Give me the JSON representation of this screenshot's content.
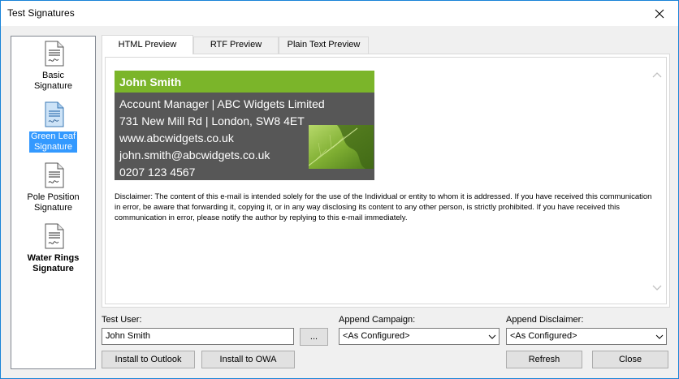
{
  "window": {
    "title": "Test Signatures"
  },
  "signatures": [
    {
      "label_line1": "Basic",
      "label_line2": "Signature",
      "selected": false,
      "bold": false
    },
    {
      "label_line1": "Green Leaf",
      "label_line2": "Signature",
      "selected": true,
      "bold": false
    },
    {
      "label_line1": "Pole Position",
      "label_line2": "Signature",
      "selected": false,
      "bold": false
    },
    {
      "label_line1": "Water Rings",
      "label_line2": "Signature",
      "selected": false,
      "bold": true
    }
  ],
  "tabs": [
    {
      "label": "HTML Preview",
      "active": true
    },
    {
      "label": "RTF Preview",
      "active": false
    },
    {
      "label": "Plain Text Preview",
      "active": false
    }
  ],
  "preview": {
    "name": "John Smith",
    "title_company": "Account Manager | ABC Widgets Limited",
    "address": "731 New Mill Rd | London, SW8 4ET",
    "website": "www.abcwidgets.co.uk",
    "email": "john.smith@abcwidgets.co.uk",
    "phone": "0207 123 4567",
    "disclaimer": "Disclaimer: The content of this e-mail is intended solely for the use of the Individual or entity to whom it is addressed. If you have received this communication in error, be aware that forwarding it, copying it, or in any way disclosing its content to any other person, is strictly prohibited. If you have received this communication in error, please notify the author by replying to this e-mail immediately.",
    "colors": {
      "header_bar": "#7bb52a",
      "body_bg": "#575757"
    }
  },
  "controls": {
    "test_user_label": "Test User:",
    "test_user_value": "John Smith",
    "browse_button": "...",
    "append_campaign_label": "Append Campaign:",
    "append_campaign_value": "<As Configured>",
    "append_disclaimer_label": "Append Disclaimer:",
    "append_disclaimer_value": "<As Configured>",
    "install_outlook": "Install to Outlook",
    "install_owa": "Install to OWA",
    "refresh": "Refresh",
    "close": "Close"
  },
  "icons": {
    "close": "close-icon",
    "document": "signature-document-icon",
    "scroll_up": "chevron-up-icon",
    "scroll_down": "chevron-down-icon",
    "dropdown": "chevron-down-icon"
  }
}
